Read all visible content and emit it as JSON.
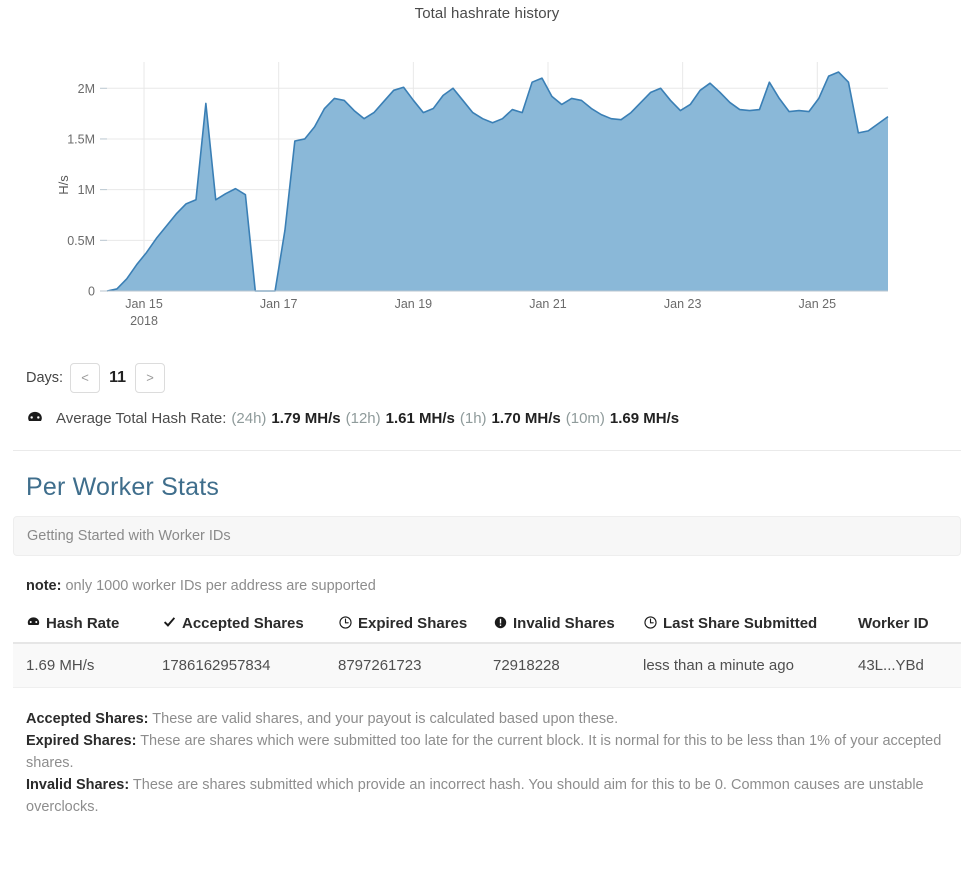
{
  "chart_data": {
    "type": "area",
    "title": "Total hashrate history",
    "xlabel": "",
    "ylabel": "H/s",
    "ylim": [
      0,
      2200000
    ],
    "yticks": [
      0,
      500000,
      1000000,
      1500000,
      2000000
    ],
    "ytick_labels": [
      "0",
      "0.5M",
      "1M",
      "1.5M",
      "2M"
    ],
    "xtick_labels": [
      "Jan 15",
      "Jan 17",
      "Jan 19",
      "Jan 21",
      "Jan 23",
      "Jan 25"
    ],
    "x_sublabel": "2018",
    "grid": true,
    "legend": "none",
    "line_color": "#3a7fb5",
    "fill_color": "#8ab8d8",
    "series": [
      {
        "name": "Total hashrate",
        "x": [
          "Jan 14.95",
          "Jan 15.05",
          "Jan 15.15",
          "Jan 15.25",
          "Jan 15.35",
          "Jan 15.45",
          "Jan 15.55",
          "Jan 15.65",
          "Jan 15.75",
          "Jan 15.85",
          "Jan 15.88",
          "Jan 15.90",
          "Jan 15.92",
          "Jan 15.95",
          "Jan 16.00",
          "Jan 16.05",
          "Jan 16.10",
          "Jan 16.15",
          "Jan 16.20",
          "Jan 16.22",
          "Jan 16.25",
          "Jan 16.30",
          "Jan 16.40",
          "Jan 16.45",
          "Jan 16.55",
          "Jan 16.65",
          "Jan 16.75",
          "Jan 16.85",
          "Jan 16.95",
          "Jan 17.05",
          "Jan 17.15",
          "Jan 17.30",
          "Jan 17.45",
          "Jan 17.55",
          "Jan 17.70",
          "Jan 17.85",
          "Jan 18.00",
          "Jan 18.15",
          "Jan 18.30",
          "Jan 18.45",
          "Jan 18.60",
          "Jan 18.75",
          "Jan 18.90",
          "Jan 19.00",
          "Jan 19.10",
          "Jan 19.25",
          "Jan 19.40",
          "Jan 19.55",
          "Jan 19.70",
          "Jan 19.85",
          "Jan 20.00",
          "Jan 20.15",
          "Jan 20.30",
          "Jan 20.45",
          "Jan 20.60",
          "Jan 20.80",
          "Jan 21.00",
          "Jan 21.20",
          "Jan 21.40",
          "Jan 21.60",
          "Jan 21.80",
          "Jan 22.00",
          "Jan 22.20",
          "Jan 22.40",
          "Jan 22.60",
          "Jan 22.80",
          "Jan 23.00",
          "Jan 23.20",
          "Jan 23.40",
          "Jan 23.60",
          "Jan 23.80",
          "Jan 24.00",
          "Jan 24.20",
          "Jan 24.40",
          "Jan 24.60",
          "Jan 24.80",
          "Jan 25.00",
          "Jan 25.20",
          "Jan 25.40",
          "Jan 25.55"
        ],
        "values": [
          0,
          20000,
          120000,
          260000,
          380000,
          520000,
          640000,
          760000,
          860000,
          900000,
          1850000,
          900000,
          960000,
          1010000,
          950000,
          0,
          0,
          0,
          600000,
          1480000,
          1500000,
          1620000,
          1800000,
          1900000,
          1880000,
          1780000,
          1700000,
          1760000,
          1870000,
          1980000,
          2010000,
          1880000,
          1760000,
          1800000,
          1930000,
          2000000,
          1880000,
          1760000,
          1700000,
          1660000,
          1700000,
          1790000,
          1760000,
          2060000,
          2100000,
          1920000,
          1840000,
          1900000,
          1880000,
          1800000,
          1740000,
          1700000,
          1690000,
          1760000,
          1860000,
          1960000,
          2000000,
          1880000,
          1780000,
          1840000,
          1980000,
          2050000,
          1960000,
          1860000,
          1790000,
          1780000,
          1790000,
          2060000,
          1900000,
          1770000,
          1780000,
          1770000,
          1900000,
          2120000,
          2160000,
          2060000,
          1560000,
          1580000,
          1650000,
          1720000
        ]
      }
    ]
  },
  "days": {
    "label": "Days:",
    "prev_label": "<",
    "next_label": ">",
    "value": "11"
  },
  "average": {
    "icon": "tachometer-icon",
    "label": "Average Total Hash Rate:",
    "entries": [
      {
        "period": "(24h)",
        "value": "1.79 MH/s"
      },
      {
        "period": "(12h)",
        "value": "1.61 MH/s"
      },
      {
        "period": "(1h)",
        "value": "1.70 MH/s"
      },
      {
        "period": "(10m)",
        "value": "1.69 MH/s"
      }
    ]
  },
  "per_worker": {
    "heading": "Per Worker Stats",
    "info_box": "Getting Started with Worker IDs",
    "note_bold": "note:",
    "note_text": " only 1000 worker IDs per address are supported",
    "columns": [
      {
        "label": "Hash Rate",
        "icon": "tachometer-icon"
      },
      {
        "label": "Accepted Shares",
        "icon": "check-icon"
      },
      {
        "label": "Expired Shares",
        "icon": "clock-icon"
      },
      {
        "label": "Invalid Shares",
        "icon": "exclamation-circle-icon"
      },
      {
        "label": "Last Share Submitted",
        "icon": "clock-icon"
      },
      {
        "label": "Worker ID",
        "icon": ""
      }
    ],
    "rows": [
      {
        "hash_rate": "1.69 MH/s",
        "accepted_shares": "1786162957834",
        "expired_shares": "8797261723",
        "invalid_shares": "72918228",
        "last_share_submitted": "less than a minute ago",
        "worker_id": "43L...YBd"
      }
    ]
  },
  "explanations": [
    {
      "term": "Accepted Shares:",
      "text": " These are valid shares, and your payout is calculated based upon these."
    },
    {
      "term": "Expired Shares:",
      "text": " These are shares which were submitted too late for the current block. It is normal for this to be less than 1% of your accepted shares."
    },
    {
      "term": "Invalid Shares:",
      "text": " These are shares submitted which provide an incorrect hash. You should aim for this to be 0. Common causes are unstable overclocks."
    }
  ],
  "colors": {
    "chart_line": "#3a7fb5",
    "chart_fill": "#8ab8d8",
    "heading": "#3f6e8c",
    "muted": "#8d8d8d"
  }
}
